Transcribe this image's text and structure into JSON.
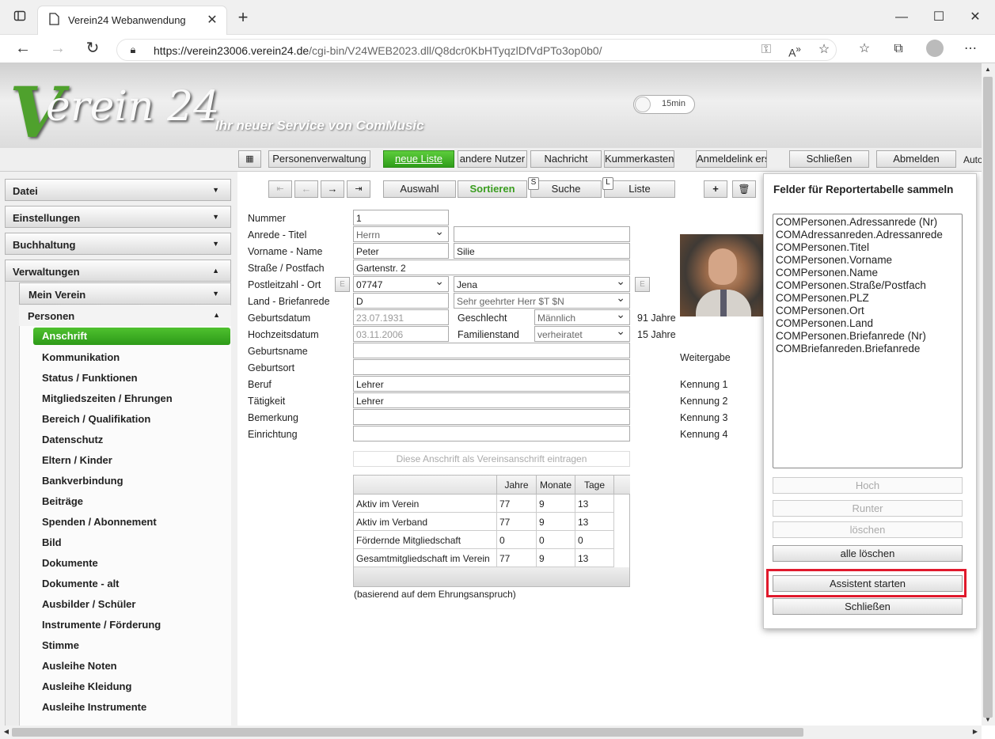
{
  "browser": {
    "tab_title": "Verein24 Webanwendung",
    "url_host": "https://verein23006.verein24.de",
    "url_path": "/cgi-bin/V24WEB2023.dll/Q8dcr0KbHTyqzlDfVdPTo3op0b0/"
  },
  "header": {
    "logo_v": "V",
    "logo_rest": "erein 24",
    "slogan": "Ihr neuer Service von ComMusic",
    "timer": "15min"
  },
  "toolbar": {
    "personenverwaltung": "Personenverwaltung",
    "neue_liste": "neue Liste",
    "andere_nutzer": "andere Nutzer",
    "nachricht": "Nachricht",
    "kummerkasten": "Kummerkasten",
    "anmeldelink": "Anmeldelink erst",
    "schliessen": "Schließen",
    "abmelden": "Abmelden",
    "auto": "Auto"
  },
  "sidebar": {
    "sections": [
      "Datei",
      "Einstellungen",
      "Buchhaltung",
      "Verwaltungen"
    ],
    "mein_verein": "Mein Verein",
    "personen": "Personen",
    "active": "Anschrift",
    "items": [
      "Kommunikation",
      "Status / Funktionen",
      "Mitgliedszeiten / Ehrungen",
      "Bereich / Qualifikation",
      "Datenschutz",
      "Eltern / Kinder",
      "Bankverbindung",
      "Beiträge",
      "Spenden / Abonnement",
      "Bild",
      "Dokumente",
      "Dokumente - alt",
      "Ausbilder / Schüler",
      "Instrumente / Förderung",
      "Stimme",
      "Ausleihe Noten",
      "Ausleihe Kleidung",
      "Ausleihe Instrumente"
    ]
  },
  "nav": {
    "auswahl": "Auswahl",
    "sortieren": "Sortieren",
    "suche_key": "S",
    "suche": "Suche",
    "liste_key": "L",
    "liste": "Liste"
  },
  "form": {
    "labels": {
      "nummer": "Nummer",
      "anrede": "Anrede - Titel",
      "vorname": "Vorname - Name",
      "strasse": "Straße / Postfach",
      "plz": "Postleitzahl - Ort",
      "land": "Land - Briefanrede",
      "geburtsdatum": "Geburtsdatum",
      "hochzeitsdatum": "Hochzeitsdatum",
      "geburtsname": "Geburtsname",
      "geburtsort": "Geburtsort",
      "beruf": "Beruf",
      "taetigkeit": "Tätigkeit",
      "bemerkung": "Bemerkung",
      "einrichtung": "Einrichtung",
      "geschlecht": "Geschlecht",
      "familienstand": "Familienstand"
    },
    "values": {
      "nummer": "1",
      "anrede": "Herrn",
      "titel": "",
      "vorname": "Peter",
      "name": "Silie",
      "strasse": "Gartenstr. 2",
      "plz": "07747",
      "ort": "Jena",
      "land": "D",
      "briefanrede": "Sehr geehrter Herr $T $N",
      "geburtsdatum": "23.07.1931",
      "hochzeitsdatum": "03.11.2006",
      "geschlecht": "Männlich",
      "familienstand": "verheiratet",
      "alter": "91 Jahre",
      "ehejahre": "15 Jahre",
      "beruf": "Lehrer",
      "taetigkeit": "Lehrer"
    },
    "e_label": "E",
    "vereinsanschrift_button": "Diese Anschrift als Vereinsanschrift eintragen",
    "right_labels": {
      "weitergabe": "Weitergabe",
      "kennung1": "Kennung 1",
      "kennung2": "Kennung 2",
      "kennung3": "Kennung 3",
      "kennung4": "Kennung 4"
    },
    "table": {
      "headers": [
        "",
        "Jahre",
        "Monate",
        "Tage"
      ],
      "rows": [
        {
          "label": "Aktiv im Verein",
          "jahre": "77",
          "monate": "9",
          "tage": "13"
        },
        {
          "label": "Aktiv im Verband",
          "jahre": "77",
          "monate": "9",
          "tage": "13"
        },
        {
          "label": "Fördernde Mitgliedschaft",
          "jahre": "0",
          "monate": "0",
          "tage": "0"
        },
        {
          "label": "Gesamtmitgliedschaft im Verein",
          "jahre": "77",
          "monate": "9",
          "tage": "13"
        }
      ],
      "footnote": "(basierend auf dem Ehrungsanspruch)"
    }
  },
  "popup": {
    "title": "Felder für Reportertabelle sammeln",
    "fields": [
      "COMPersonen.Adressanrede (Nr)",
      "COMAdressanreden.Adressanrede",
      "COMPersonen.Titel",
      "COMPersonen.Vorname",
      "COMPersonen.Name",
      "COMPersonen.Straße/Postfach",
      "COMPersonen.PLZ",
      "COMPersonen.Ort",
      "COMPersonen.Land",
      "COMPersonen.Briefanrede (Nr)",
      "COMBriefanreden.Briefanrede"
    ],
    "hoch": "Hoch",
    "runter": "Runter",
    "loeschen": "löschen",
    "alle_loeschen": "alle löschen",
    "assistent": "Assistent starten",
    "schliessen": "Schließen"
  }
}
